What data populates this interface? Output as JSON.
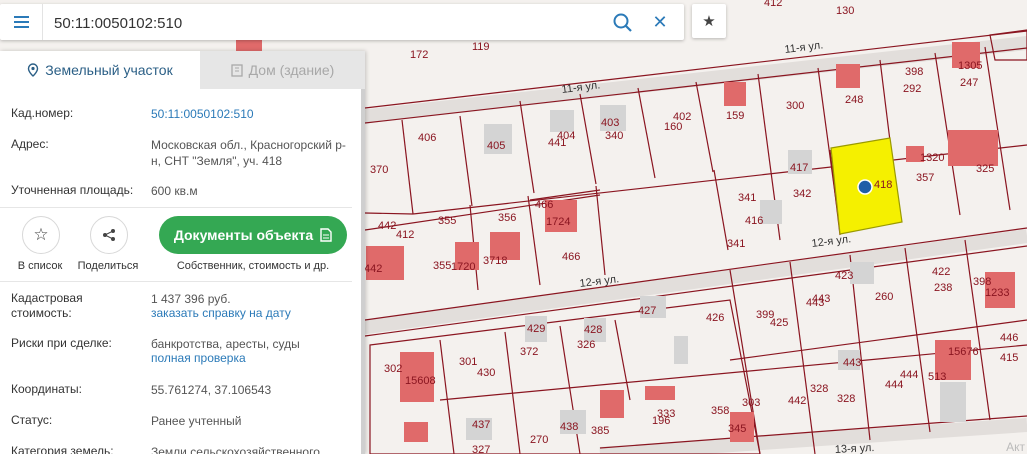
{
  "search": {
    "value": "50:11:0050102:510"
  },
  "tabs": {
    "land": "Земельный участок",
    "building": "Дом (здание)"
  },
  "info": {
    "cad_label": "Кад.номер:",
    "cad_value": "50:11:0050102:510",
    "addr_label": "Адрес:",
    "addr_value": "Московская обл., Красногорский р-н, СНТ \"Земля\", уч. 418",
    "area_label": "Уточненная площадь:",
    "area_value": "600 кв.м"
  },
  "actions": {
    "list_label": "В список",
    "share_label": "Поделиться",
    "docs_label": "Документы объекта",
    "docs_sub": "Собственник, стоимость и др."
  },
  "details": {
    "cost_label": "Кадастровая стоимость:",
    "cost_value": "1 437 396 руб.",
    "cost_link": "заказать справку на дату",
    "risks_label": "Риски при сделке:",
    "risks_value": "банкротства, аресты, суды",
    "risks_link": "полная проверка",
    "coords_label": "Координаты:",
    "coords_value": "55.761274, 37.106543",
    "status_label": "Статус:",
    "status_value": "Ранее учтенный",
    "category_label": "Категория земель:",
    "category_value": "Земли сельскохозяйственного"
  },
  "map": {
    "streets": [
      "11-я ул.",
      "11-я ул.",
      "12-я ул.",
      "12-я ул.",
      "13-я ул."
    ],
    "parcels": [
      "130",
      "412",
      "172",
      "119",
      "1305",
      "398",
      "292",
      "247",
      "248",
      "300",
      "159",
      "402",
      "160",
      "403",
      "340",
      "404",
      "441",
      "405",
      "406",
      "370",
      "417",
      "418",
      "1320",
      "357",
      "325",
      "341",
      "342",
      "416",
      "341",
      "442",
      "412",
      "355",
      "355",
      "1720",
      "356",
      "3718",
      "466",
      "1724",
      "466",
      "442",
      "427",
      "426",
      "423",
      "422",
      "238",
      "398",
      "1233",
      "260",
      "443",
      "399",
      "425",
      "443",
      "446",
      "415",
      "429",
      "372",
      "428",
      "326",
      "302",
      "15608",
      "301",
      "430",
      "443",
      "328",
      "444",
      "444",
      "513",
      "15676",
      "303",
      "442",
      "328",
      "437",
      "327",
      "270",
      "438",
      "385",
      "333",
      "196",
      "358",
      "345"
    ],
    "attribution": "Акт"
  }
}
